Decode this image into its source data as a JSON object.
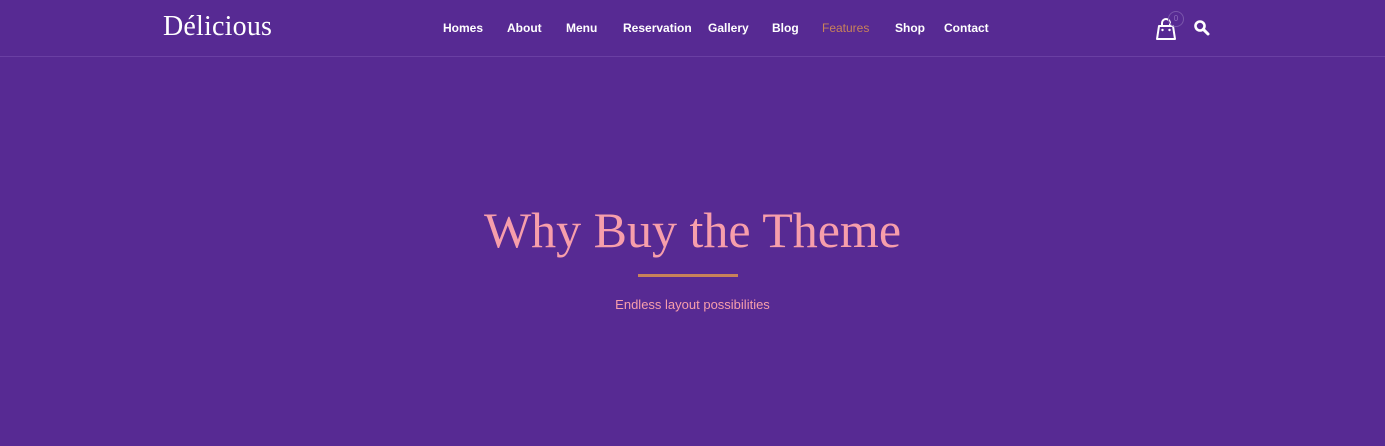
{
  "header": {
    "logo": "Délicious",
    "nav": [
      {
        "label": "Homes",
        "active": false
      },
      {
        "label": "About",
        "active": false
      },
      {
        "label": "Menu",
        "active": false
      },
      {
        "label": "Reservation",
        "active": false
      },
      {
        "label": "Gallery",
        "active": false
      },
      {
        "label": "Blog",
        "active": false
      },
      {
        "label": "Features",
        "active": true
      },
      {
        "label": "Shop",
        "active": false
      },
      {
        "label": "Contact",
        "active": false
      }
    ],
    "cart_count": "0",
    "cart_icon": "shopping-bag-icon",
    "search_icon": "search-icon"
  },
  "hero": {
    "title": "Why Buy the Theme",
    "subtitle": "Endless layout possibilities"
  },
  "colors": {
    "background": "#572a93",
    "accent": "#c9825a",
    "title": "#f79eab",
    "nav_text": "#ffffff"
  }
}
